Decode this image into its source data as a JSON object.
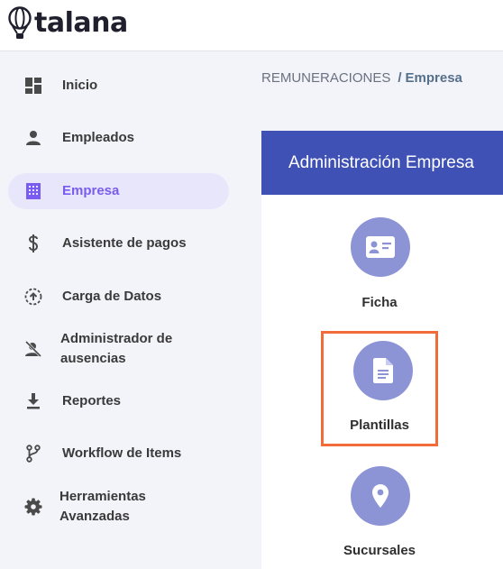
{
  "brand": {
    "name": "talana"
  },
  "sidebar": {
    "items": [
      {
        "label": "Inicio",
        "icon": "dashboard-icon",
        "active": false
      },
      {
        "label": "Empleados",
        "icon": "person-icon",
        "active": false
      },
      {
        "label": "Empresa",
        "icon": "building-icon",
        "active": true
      },
      {
        "label": "Asistente de pagos",
        "icon": "dollar-icon",
        "active": false
      },
      {
        "label": "Carga de Datos",
        "icon": "upload-icon",
        "active": false
      },
      {
        "label": "Administrador de ausencias",
        "icon": "person-off-icon",
        "active": false
      },
      {
        "label": "Reportes",
        "icon": "download-icon",
        "active": false
      },
      {
        "label": "Workflow de Items",
        "icon": "branch-icon",
        "active": false
      },
      {
        "label": "Herramientas Avanzadas",
        "icon": "gear-icon",
        "active": false
      }
    ]
  },
  "breadcrumb": {
    "section": "REMUNERACIONES",
    "separator": "/",
    "current": "Empresa"
  },
  "panel": {
    "title": "Administración Empresa",
    "cards": [
      {
        "label": "Ficha",
        "icon": "id-card-icon"
      },
      {
        "label": "Plantillas",
        "icon": "document-icon"
      },
      {
        "label": "Sucursales",
        "icon": "location-pin-icon"
      }
    ]
  },
  "colors": {
    "accent": "#7b5cf0",
    "header": "#3f51b5",
    "card_circle": "#8c94d6",
    "highlight": "#f26b3a"
  }
}
